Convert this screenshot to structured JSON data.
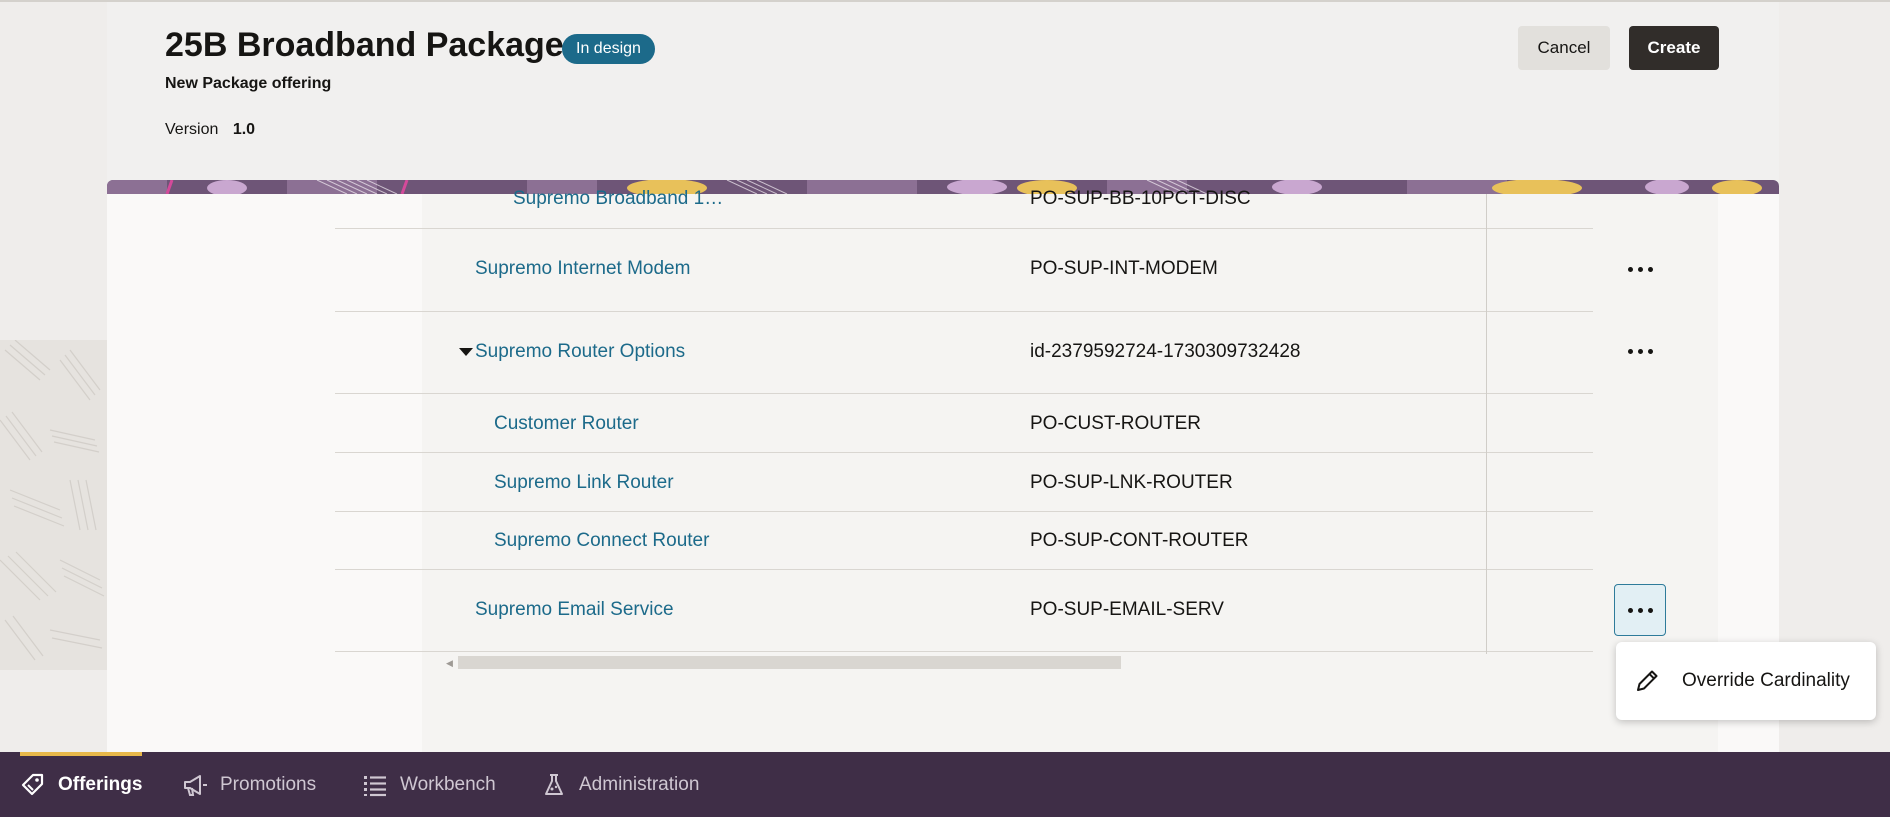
{
  "header": {
    "title": "25B Broadband Package",
    "status_badge": "In design",
    "subtitle": "New Package offering",
    "version_label": "Version",
    "version_value": "1.0",
    "cancel_label": "Cancel",
    "create_label": "Create"
  },
  "table": {
    "rows": [
      {
        "name": "Supremo Broadband 1…",
        "id": "PO-SUP-BB-10PCT-DISC",
        "has_actions": false
      },
      {
        "name": "Supremo Internet Modem",
        "id": "PO-SUP-INT-MODEM",
        "has_actions": true
      },
      {
        "name": "Supremo Router Options",
        "id": "id-2379592724-1730309732428",
        "has_actions": true,
        "expanded": true
      },
      {
        "name": "Customer Router",
        "id": "PO-CUST-ROUTER",
        "has_actions": false
      },
      {
        "name": "Supremo Link Router",
        "id": "PO-SUP-LNK-ROUTER",
        "has_actions": false
      },
      {
        "name": "Supremo Connect Router",
        "id": "PO-SUP-CONT-ROUTER",
        "has_actions": false
      },
      {
        "name": "Supremo Email Service",
        "id": "PO-SUP-EMAIL-SERV",
        "has_actions": true,
        "actions_active": true
      }
    ]
  },
  "context_menu": {
    "items": [
      {
        "label": "Override Cardinality",
        "icon": "pencil-icon"
      }
    ]
  },
  "navbar": {
    "items": [
      {
        "label": "Offerings",
        "icon": "tag-icon",
        "selected": true
      },
      {
        "label": "Promotions",
        "icon": "megaphone-icon",
        "selected": false
      },
      {
        "label": "Workbench",
        "icon": "list-icon",
        "selected": false
      },
      {
        "label": "Administration",
        "icon": "flask-icon",
        "selected": false
      }
    ]
  },
  "colors": {
    "accent_link": "#1c6a8a",
    "badge_bg": "#1c6a8a",
    "nav_bg": "#3f2e47",
    "nav_indicator": "#e8b84a",
    "create_bg": "#312d2a"
  }
}
